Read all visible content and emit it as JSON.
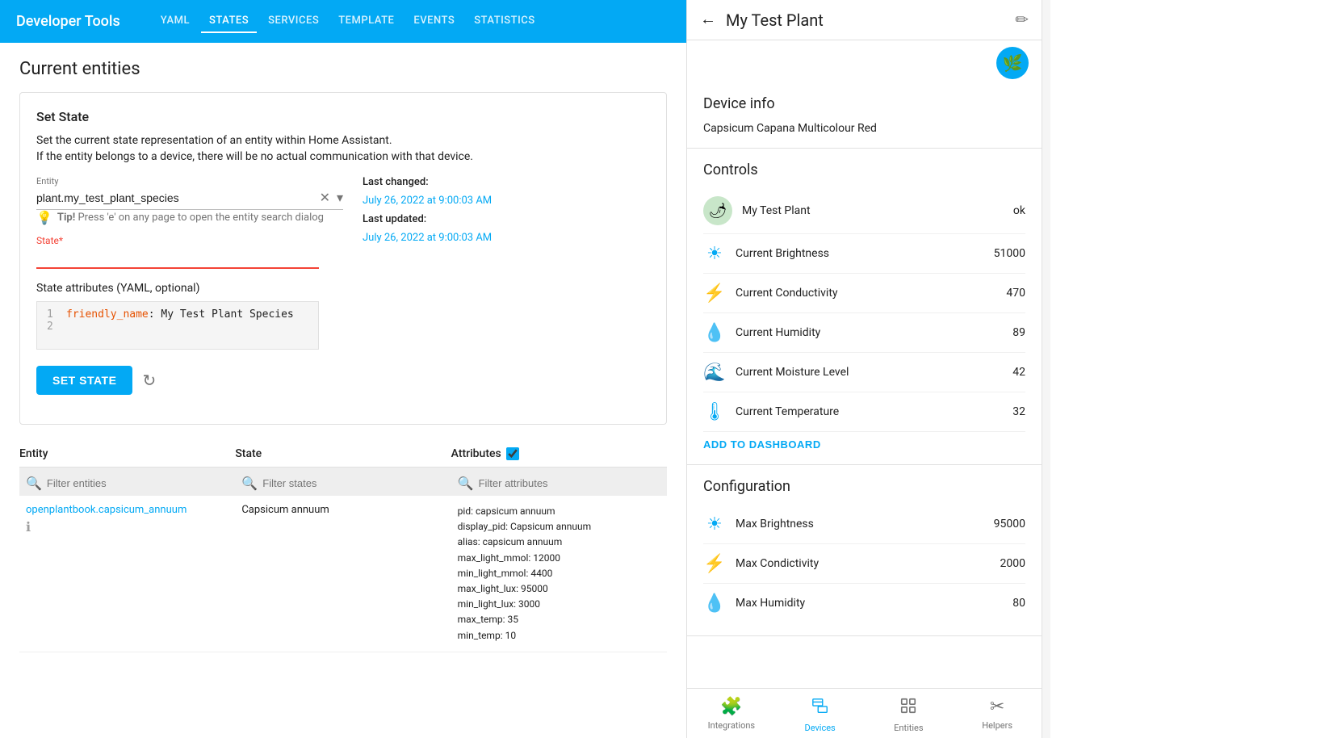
{
  "app": {
    "title": "Developer Tools"
  },
  "nav": {
    "tabs": [
      "YAML",
      "STATES",
      "SERVICES",
      "TEMPLATE",
      "EVENTS",
      "STATISTICS"
    ],
    "active": "STATES"
  },
  "main": {
    "section_title": "Current entities",
    "set_state_card": {
      "title": "Set State",
      "desc1": "Set the current state representation of an entity within Home Assistant.",
      "desc2": "If the entity belongs to a device, there will be no actual communication with that device.",
      "entity_label": "Entity",
      "entity_value": "plant.my_test_plant_species",
      "state_label": "State*",
      "state_placeholder": "",
      "state_attrs_label": "State attributes (YAML, optional)",
      "code_line1_num": "1",
      "code_line1_key": "friendly_name",
      "code_line1_rest": ": My Test Plant Species",
      "code_line2_num": "2",
      "tip_text": "Tip!",
      "tip_rest": "Press 'e' on any page to open the entity search dialog",
      "last_changed_label": "Last changed:",
      "last_changed_value": "July 26, 2022 at 9:00:03 AM",
      "last_updated_label": "Last updated:",
      "last_updated_value": "July 26, 2022 at 9:00:03 AM",
      "set_state_btn": "SET STATE"
    },
    "table": {
      "cols": [
        "Entity",
        "State",
        "Attributes"
      ],
      "filter_entity_placeholder": "Filter entities",
      "filter_state_placeholder": "Filter states",
      "filter_attrs_placeholder": "Filter attributes",
      "rows": [
        {
          "entity_link": "openplantbook.capsicum_annuum",
          "state": "Capsicum annuum",
          "attributes": "pid: capsicum annuum\ndisplay_pid: Capsicum annuum\nalias: capsicum annuum\nmax_light_mmol: 12000\nmin_light_mmol: 4400\nmax_light_lux: 95000\nmin_light_lux: 3000\nmax_temp: 35\nmin_temp: 10"
        }
      ]
    }
  },
  "right_panel": {
    "title": "My Test Plant",
    "header_title": "My Test Plant",
    "device_info": {
      "section_title": "Device info",
      "description": "Capsicum Capana Multicolour Red"
    },
    "controls": {
      "section_title": "Controls",
      "items": [
        {
          "name": "My Test Plant",
          "value": "ok",
          "icon_type": "plant"
        },
        {
          "name": "Current Brightness",
          "value": "51000",
          "icon_type": "brightness"
        },
        {
          "name": "Current Conductivity",
          "value": "470",
          "icon_type": "conductivity"
        },
        {
          "name": "Current Humidity",
          "value": "89",
          "icon_type": "humidity"
        },
        {
          "name": "Current Moisture Level",
          "value": "42",
          "icon_type": "moisture"
        },
        {
          "name": "Current Temperature",
          "value": "32",
          "icon_type": "temperature"
        }
      ],
      "add_dashboard_btn": "ADD TO DASHBOARD"
    },
    "configuration": {
      "section_title": "Configuration",
      "items": [
        {
          "name": "Max Brightness",
          "value": "95000"
        },
        {
          "name": "Max Condictivity",
          "value": "2000"
        },
        {
          "name": "Max Humidity",
          "value": "80"
        }
      ]
    },
    "bottom_nav": [
      {
        "label": "Integrations",
        "icon": "puzzle",
        "active": false
      },
      {
        "label": "Devices",
        "icon": "device",
        "active": true
      },
      {
        "label": "Entities",
        "icon": "entity",
        "active": false
      },
      {
        "label": "Helpers",
        "icon": "helpers",
        "active": false
      }
    ]
  }
}
